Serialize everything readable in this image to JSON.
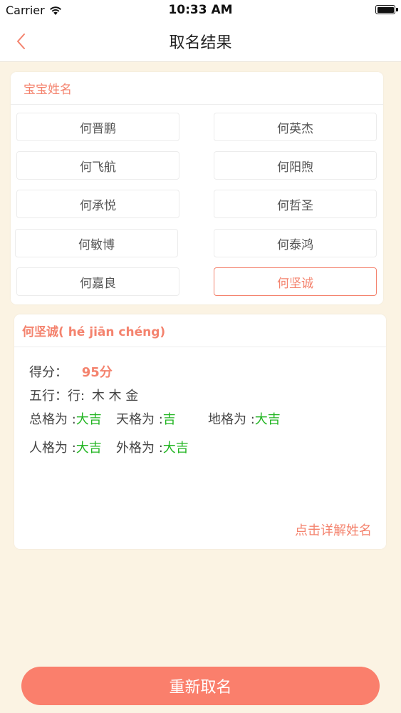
{
  "status_bar": {
    "carrier": "Carrier",
    "time": "10:33 AM",
    "icons": [
      "wifi-icon",
      "battery-icon"
    ]
  },
  "nav": {
    "title": "取名结果",
    "back_icon": "chevron-left-icon"
  },
  "names_card": {
    "header": "宝宝姓名",
    "names": [
      "何晋鹏",
      "何英杰",
      "何飞航",
      "何阳煦",
      "何承悦",
      "何哲圣",
      "何敏博",
      "何泰鸿",
      "何嘉良",
      "何坚诚"
    ],
    "selected": "何坚诚"
  },
  "detail": {
    "header": "何坚诚( hé jiān chéng)",
    "score_label": "得分：",
    "score_value": "95分",
    "wuxing_label": "五行：行:",
    "wuxing_values": "木 木 金",
    "zongge_label": "总格为 :",
    "zongge_value": "大吉",
    "tiange_label": "天格为 :",
    "tiange_value": "吉",
    "dige_label": "地格为 :",
    "dige_value": "大吉",
    "renge_label": "人格为 :",
    "renge_value": "大吉",
    "waige_label": "外格为 :",
    "waige_value": "大吉",
    "link": "点击详解姓名"
  },
  "bottom": {
    "rename_label": "重新取名"
  },
  "colors": {
    "accent": "#f4836e",
    "button": "#fa7f6c",
    "good": "#22b522",
    "background": "#fbf3e3"
  }
}
